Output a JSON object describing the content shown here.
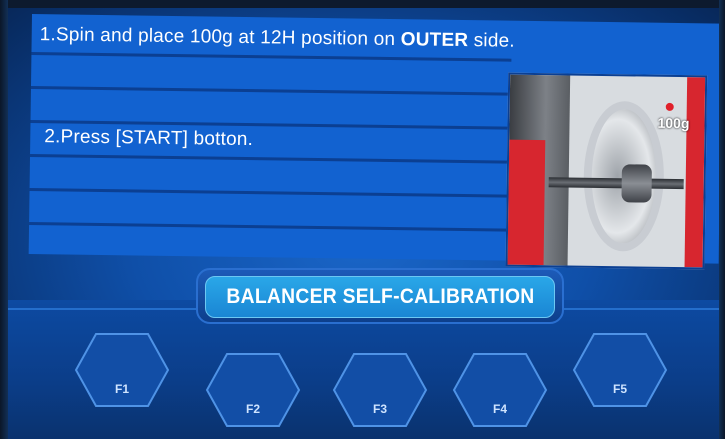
{
  "instructions": {
    "line1_prefix": "1.Spin and place 100g at 12H position on ",
    "line1_bold": "OUTER",
    "line1_suffix": " side.",
    "line2": "2.Press [START] botton."
  },
  "illustration": {
    "weight_label": "100g"
  },
  "title": "BALANCER SELF-CALIBRATION",
  "function_keys": [
    {
      "label": "F1"
    },
    {
      "label": "F2"
    },
    {
      "label": "F3"
    },
    {
      "label": "F4"
    },
    {
      "label": "F5"
    }
  ],
  "colors": {
    "panel": "#1262d0",
    "title_fill": "#1a86d4",
    "accent_red": "#d7262f"
  }
}
